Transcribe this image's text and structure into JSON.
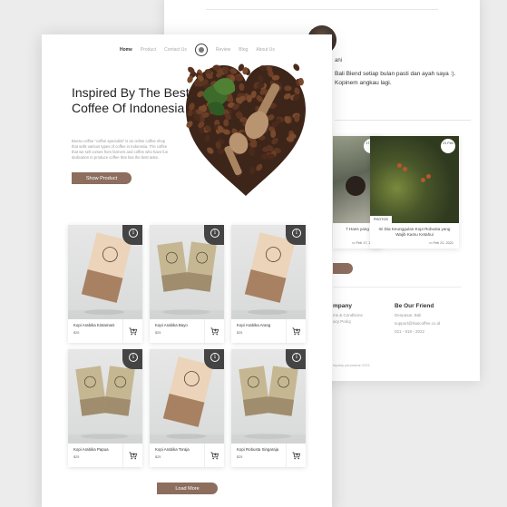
{
  "back_page": {
    "name_fragment": "ani",
    "quote": "Bali Blend  setiap bulan pasti dan ayah saya :). Kopinem angkau lagi.",
    "blog_cards": [
      {
        "date": "17 Feb",
        "tag": "",
        "title": "7 Hans yang",
        "date_line": "Feb 17, 2021"
      },
      {
        "date": "21 Feb",
        "tag": "PHOTOS",
        "title": "Ini Dia Keunggulan Kopi Robusta yang Wajib Kamu Ketahui",
        "date_line": "Feb 21, 2021"
      }
    ],
    "footer": {
      "company_title": "mpany",
      "company_items": [
        "ms & Conditions",
        "acy Policy"
      ],
      "friend_title": "Be Our Friend",
      "friend_items": [
        "Denpasar, Bali",
        "support@lisaicoffee.co.id",
        "021 - 918 - 2022"
      ],
      "copyright": "mpany yourname 2021"
    }
  },
  "nav": {
    "items_left": [
      "Home",
      "Product",
      "Contact Us"
    ],
    "items_right": [
      "Review",
      "Blog",
      "About Us"
    ]
  },
  "hero": {
    "title": "Inspired By The Best Coffee Of Indonesia",
    "description": "Beeso coffee “coffee specialist” is an online coffee shop that sells various types of coffee in Indonesia. The coffee that we sell comes from farmers and coffee who have fun dedication to produce coffee that has the best taste.",
    "button": "Show Product"
  },
  "products": [
    {
      "name": "Kopi Arabika Kintamani",
      "price": "$25",
      "bag": "peach"
    },
    {
      "name": "Kopi Arabika Bayo",
      "price": "$25",
      "bag": "olive"
    },
    {
      "name": "Kopi Arabika Arang",
      "price": "$25",
      "bag": "peach"
    },
    {
      "name": "Kopi Arabika Papua",
      "price": "$25",
      "bag": "olive"
    },
    {
      "name": "Kopi Arabika Toraja",
      "price": "$25",
      "bag": "peach"
    },
    {
      "name": "Kopi Robusta Singaraja",
      "price": "$25",
      "bag": "olive"
    }
  ],
  "load_more": "Load More",
  "colors": {
    "accent": "#8c6d5e",
    "info_tab": "#444444",
    "bag_peach": "#ecd4ba",
    "bag_olive": "#c6b793"
  }
}
